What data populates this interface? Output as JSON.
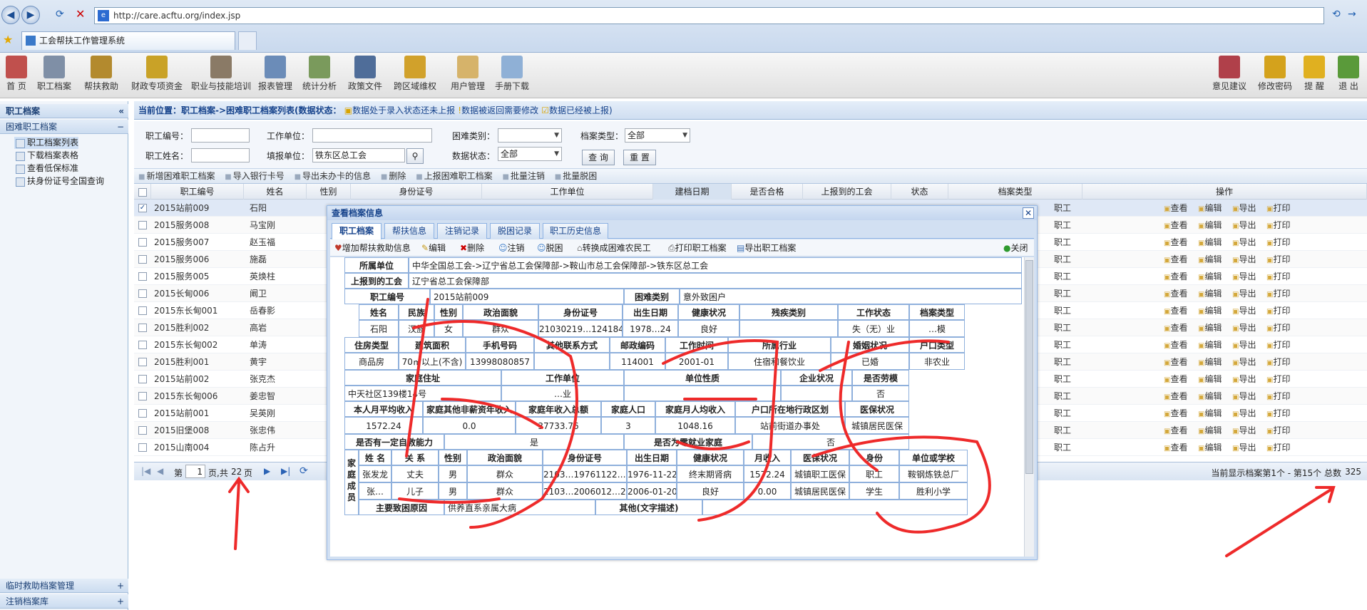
{
  "browser": {
    "url": "http://care.acftu.org/index.jsp",
    "tab_title": "工会帮扶工作管理系统"
  },
  "toolbar": {
    "left": [
      {
        "label": "首 页",
        "icon": "home-icon",
        "color": "#c0504d"
      },
      {
        "label": "职工档案",
        "icon": "document-icon",
        "color": "#7f8fa6"
      },
      {
        "label": "帮扶救助",
        "icon": "edit-icon",
        "color": "#b38a2e"
      },
      {
        "label": "财政专项资金",
        "icon": "coins-icon",
        "color": "#c9a227"
      },
      {
        "label": "职业与技能培训",
        "icon": "users-icon",
        "color": "#8a7a66"
      },
      {
        "label": "报表管理",
        "icon": "report-icon",
        "color": "#6b8cb8"
      },
      {
        "label": "统计分析",
        "icon": "chart-icon",
        "color": "#7a9a5c"
      },
      {
        "label": "政策文件",
        "icon": "book-icon",
        "color": "#4f6d99"
      },
      {
        "label": "跨区域维权",
        "icon": "warning-sign-icon",
        "color": "#d1a12b"
      },
      {
        "label": "用户管理",
        "icon": "folder-user-icon",
        "color": "#d6b36a"
      },
      {
        "label": "手册下载",
        "icon": "folder-icon",
        "color": "#8fb0d6"
      }
    ],
    "right": [
      {
        "label": "意见建议",
        "icon": "feedback-icon",
        "color": "#b0404a"
      },
      {
        "label": "修改密码",
        "icon": "lock-icon",
        "color": "#d4a21c"
      },
      {
        "label": "提 醒",
        "icon": "alert-icon",
        "color": "#e0b020"
      },
      {
        "label": "退 出",
        "icon": "exit-icon",
        "color": "#5a9a3a"
      }
    ]
  },
  "sidebar": {
    "title": "职工档案",
    "group": "困难职工档案",
    "items": [
      "职工档案列表",
      "下载档案表格",
      "查看低保标准",
      "扶身份证号全国查询"
    ],
    "bottom": [
      "临时救助档案管理",
      "注销档案库"
    ]
  },
  "breadcrumb": {
    "text": "当前位置：职工档案->困难职工档案列表(数据状态：",
    "s1": "数据处于录入状态还未上报",
    "s2": "数据被返回需要修改",
    "s3": "数据已经被上报)"
  },
  "search": {
    "emp_id_label": "职工编号：",
    "work_unit_label": "工作单位：",
    "difficulty_label": "困难类别：",
    "type_label": "档案类型：",
    "type_value": "全部",
    "name_label": "职工姓名：",
    "union_label": "填报单位：",
    "union_value": "铁东区总工会",
    "status_label": "数据状态：",
    "status_value": "全部",
    "query_btn": "查 询",
    "reset_btn": "重 置"
  },
  "actions": [
    "新增困难职工档案",
    "导入银行卡号",
    "导出未办卡的信息",
    "删除",
    "上报困难职工档案",
    "批量注销",
    "批量脱困"
  ],
  "grid": {
    "headers": [
      "职工编号",
      "姓名",
      "性别",
      "身份证号",
      "工作单位",
      "建档日期",
      "是否合格",
      "上报到的工会",
      "状态",
      "档案类型",
      "操作"
    ],
    "rows": [
      {
        "id": "2015站前009",
        "name": "石阳",
        "type": "职工",
        "checked": "✓"
      },
      {
        "id": "2015服务008",
        "name": "马宝刚",
        "type": "职工"
      },
      {
        "id": "2015服务007",
        "name": "赵玉福",
        "type": "职工"
      },
      {
        "id": "2015服务006",
        "name": "施磊",
        "type": "职工"
      },
      {
        "id": "2015服务005",
        "name": "英焕柱",
        "type": "职工"
      },
      {
        "id": "2015长甸006",
        "name": "阚卫",
        "type": "职工"
      },
      {
        "id": "2015东长甸001",
        "name": "岳春影",
        "type": "职工"
      },
      {
        "id": "2015胜利002",
        "name": "高岩",
        "type": "职工"
      },
      {
        "id": "2015东长甸002",
        "name": "单涛",
        "type": "职工"
      },
      {
        "id": "2015胜利001",
        "name": "黄宇",
        "type": "职工"
      },
      {
        "id": "2015站前002",
        "name": "张克杰",
        "type": "职工"
      },
      {
        "id": "2015东长甸006",
        "name": "姜忠智",
        "type": "职工"
      },
      {
        "id": "2015站前001",
        "name": "吴英刚",
        "type": "职工"
      },
      {
        "id": "2015旧堡008",
        "name": "张忠伟",
        "type": "职工"
      },
      {
        "id": "2015山南004",
        "name": "陈占升",
        "type": "职工"
      }
    ],
    "op_view": "查看",
    "op_edit": "编辑",
    "op_export": "导出",
    "op_print": "打印"
  },
  "pager": {
    "page_label": "第",
    "page": "1",
    "of_label": "页,共",
    "total_pages": "22",
    "pages_suffix": "页",
    "summary": "当前显示档案第1个 - 第15个 总数",
    "total": "325"
  },
  "modal": {
    "title": "查看档案信息",
    "tabs": [
      "职工档案",
      "帮扶信息",
      "注销记录",
      "脱困记录",
      "职工历史信息"
    ],
    "actions": [
      "增加帮扶救助信息",
      "编辑",
      "删除",
      "注销",
      "脱困",
      "转换成困难农民工",
      "打印职工档案",
      "导出职工档案"
    ],
    "close": "关闭",
    "rec": {
      "unit_label": "所属单位",
      "unit": "中华全国总工会->辽宁省总工会保障部->鞍山市总工会保障部->铁东区总工会",
      "report_label": "上报到的工会",
      "report": "辽宁省总工会保障部",
      "id_label": "职工编号",
      "id": "2015站前009",
      "diff_label": "困难类别",
      "diff": "意外致困户",
      "h1": [
        "姓名",
        "民族",
        "性别",
        "政治面貌",
        "身份证号",
        "出生日期",
        "健康状况",
        "残疾类别",
        "工作状态",
        "档案类型"
      ],
      "v1": [
        "石阳",
        "汉族",
        "女",
        "群众",
        "21030219…1241841",
        "1978…24",
        "良好",
        "",
        "失（无）业",
        "…模"
      ],
      "h2": [
        "住房类型",
        "建筑面积",
        "手机号码",
        "其他联系方式",
        "邮政编码",
        "工作时间",
        "所属行业",
        "婚姻状况",
        "户口类型"
      ],
      "v2": [
        "商品房",
        "70㎡以上(不含)",
        "13998080857",
        "",
        "114001",
        "2001-01",
        "住宿和餐饮业",
        "已婚",
        "非农业"
      ],
      "addr_label": "家庭住址",
      "addr": "中天社区139楼14号",
      "work_label": "工作单位",
      "work": "…业",
      "nature_label": "单位性质",
      "ent_label": "企业状况",
      "model_label": "是否劳模",
      "model": "否",
      "h3": [
        "本人月平均收入",
        "家庭其他非薪资年收入",
        "家庭年收入总额",
        "家庭人口",
        "家庭月人均收入",
        "户口所在地行政区划",
        "医保状况"
      ],
      "v3": [
        "1572.24",
        "0.0",
        "37733.76",
        "3",
        "1048.16",
        "站前街道办事处",
        "城镇居民医保"
      ],
      "self_label": "是否有一定自救能力",
      "self": "是",
      "zero_label": "是否为零就业家庭",
      "zero": "否",
      "family_label": "家庭成员",
      "fh": [
        "姓 名",
        "关 系",
        "性别",
        "政治面貌",
        "身份证号",
        "出生日期",
        "健康状况",
        "月收入",
        "医保状况",
        "身份",
        "单位或学校"
      ],
      "f1": [
        "张发龙",
        "丈夫",
        "男",
        "群众",
        "2103…19761122…10",
        "1976-11-22",
        "终末期肾病",
        "1572.24",
        "城镇职工医保",
        "职工",
        "鞍钢炼铁总厂"
      ],
      "f2": [
        "张…",
        "儿子",
        "男",
        "群众",
        "2103…2006012…23",
        "2006-01-20",
        "良好",
        "0.00",
        "城镇居民医保",
        "学生",
        "胜利小学"
      ],
      "cause_label": "主要致困原因",
      "cause": "供养直系亲属大病",
      "other_label": "其他(文字描述)"
    }
  }
}
